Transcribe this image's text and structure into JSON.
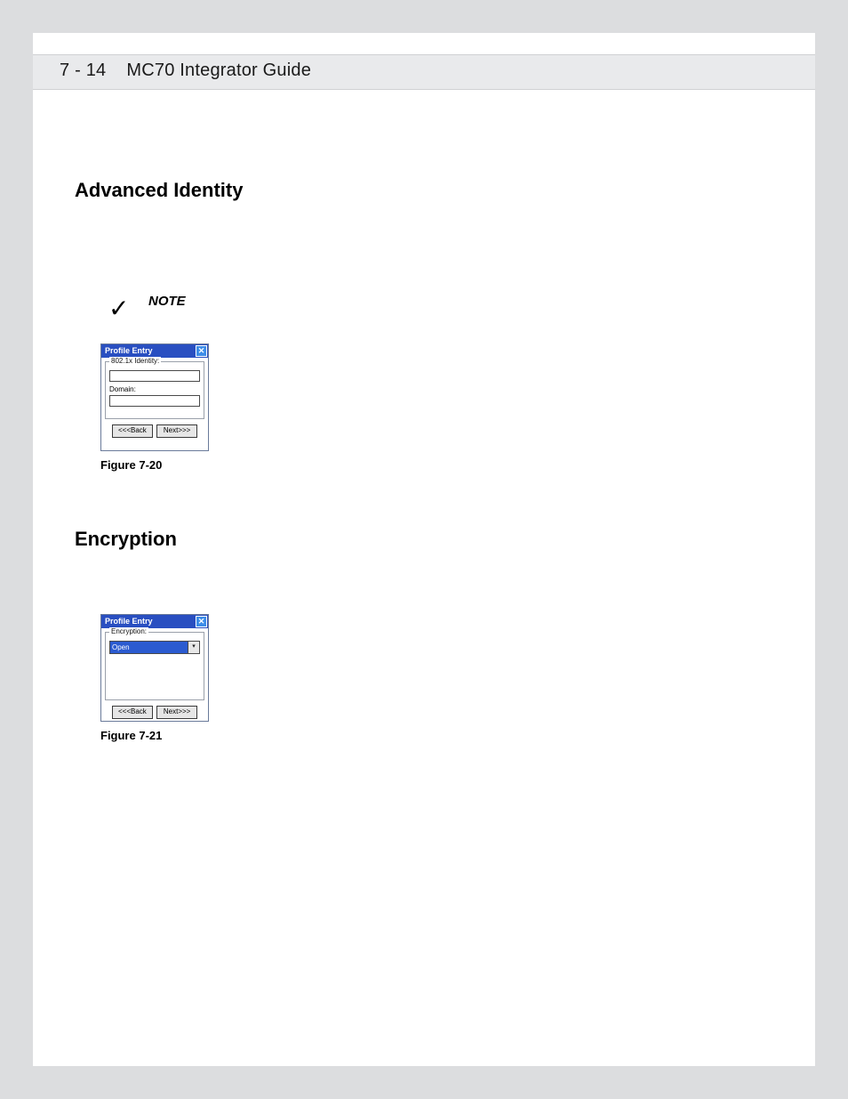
{
  "header": {
    "page_num": "7 - 14",
    "title": "MC70 Integrator Guide"
  },
  "section1": {
    "title": "Advanced Identity"
  },
  "note": {
    "label": "NOTE"
  },
  "dlg1": {
    "title": "Profile Entry",
    "group_label": "802.1x Identity:",
    "field2_label": "Domain:",
    "back": "<<<Back",
    "next": "Next>>>"
  },
  "fig1": {
    "caption": "Figure 7-20"
  },
  "section2": {
    "title": "Encryption"
  },
  "dlg2": {
    "title": "Profile Entry",
    "group_label": "Encryption:",
    "select_value": "Open",
    "back": "<<<Back",
    "next": "Next>>>"
  },
  "fig2": {
    "caption": "Figure 7-21"
  }
}
